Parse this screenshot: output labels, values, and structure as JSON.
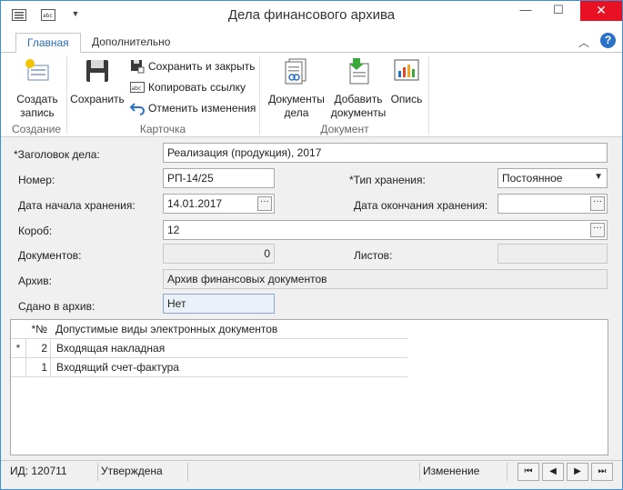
{
  "window": {
    "title": "Дела финансового архива"
  },
  "tabs": [
    {
      "label": "Главная"
    },
    {
      "label": "Дополнительно"
    }
  ],
  "ribbon": {
    "create_label_1": "Создать",
    "create_label_2": "запись",
    "group_create": "Создание",
    "save_label": "Сохранить",
    "save_close_label": "Сохранить и закрыть",
    "copy_link_label": "Копировать ссылку",
    "cancel_changes_label": "Отменить изменения",
    "group_card": "Карточка",
    "docs_label_1": "Документы",
    "docs_label_2": "дела",
    "add_docs_label_1": "Добавить",
    "add_docs_label_2": "документы",
    "inventory_label": "Опись",
    "group_document": "Документ"
  },
  "form": {
    "title_label": "*Заголовок дела:",
    "title_value": "Реализация (продукция), 2017",
    "number_label": "Номер:",
    "number_value": "РП-14/25",
    "storage_type_label": "*Тип хранения:",
    "storage_type_value": "Постоянное",
    "start_date_label": "Дата начала хранения:",
    "start_date_value": "14.01.2017",
    "end_date_label": "Дата окончания хранения:",
    "end_date_value": "",
    "box_label": "Короб:",
    "box_value": "12",
    "docs_count_label": "Документов:",
    "docs_count_value": "0",
    "sheets_label": "Листов:",
    "sheets_value": "",
    "archive_label": "Архив:",
    "archive_value": "Архив финансовых документов",
    "handed_label": "Сдано в архив:",
    "handed_value": "Нет"
  },
  "grid": {
    "col_num": "*№",
    "col_name": "Допустимые виды электронных документов",
    "rows": [
      {
        "marker": "*",
        "num": "2",
        "name": "Входящая накладная"
      },
      {
        "marker": "",
        "num": "1",
        "name": "Входящий счет-фактура"
      }
    ]
  },
  "status": {
    "id": "ИД: 120711",
    "state": "Утверждена",
    "mode": "Изменение"
  },
  "nav": {
    "first": "⏮",
    "prev": "◀",
    "next": "▶",
    "last": "⏭"
  }
}
